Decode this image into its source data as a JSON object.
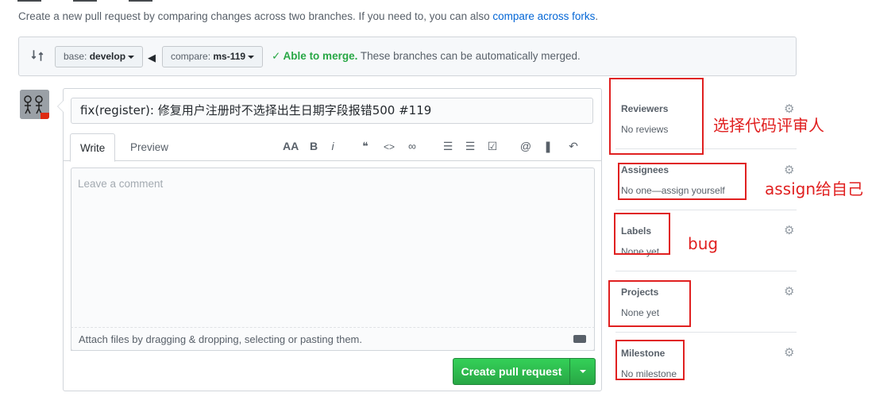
{
  "subtitle": {
    "text": "Create a new pull request by comparing changes across two branches. If you need to, you can also ",
    "link": "compare across forks",
    "end": "."
  },
  "range": {
    "base_prefix": "base: ",
    "base_branch": "develop",
    "compare_prefix": "compare: ",
    "compare_branch": "ms-119",
    "merge_ok": "✓ Able to merge.",
    "merge_text": " These branches can be automatically merged."
  },
  "composer": {
    "title_value": "fix(register): 修复用户注册时不选择出生日期字段报错500 #119",
    "tab_write": "Write",
    "tab_preview": "Preview",
    "comment_placeholder": "Leave a comment",
    "attach_text": "Attach files by dragging & dropping, selecting or pasting them.",
    "create_button": "Create pull request"
  },
  "toolbar": {
    "heading": "AA",
    "bold": "B",
    "italic": "i",
    "quote": "❝",
    "code": "<>",
    "link": "∞",
    "ul": "☰",
    "ol": "☰",
    "tasks": "☑",
    "mention": "@",
    "bookmark": "❚",
    "reply": "↶"
  },
  "sidebar": {
    "reviewers": {
      "label": "Reviewers",
      "value": "No reviews"
    },
    "assignees": {
      "label": "Assignees",
      "value": "No one—assign yourself"
    },
    "labels": {
      "label": "Labels",
      "value": "None yet"
    },
    "projects": {
      "label": "Projects",
      "value": "None yet"
    },
    "milestone": {
      "label": "Milestone",
      "value": "No milestone"
    }
  },
  "annotations": {
    "reviewers": "选择代码评审人",
    "assignees": "assign给自己",
    "labels": "bug"
  },
  "colors": {
    "link": "#0366d6",
    "success": "#28a745",
    "annotation": "#e02020",
    "create_button": "#2cbe4e"
  }
}
